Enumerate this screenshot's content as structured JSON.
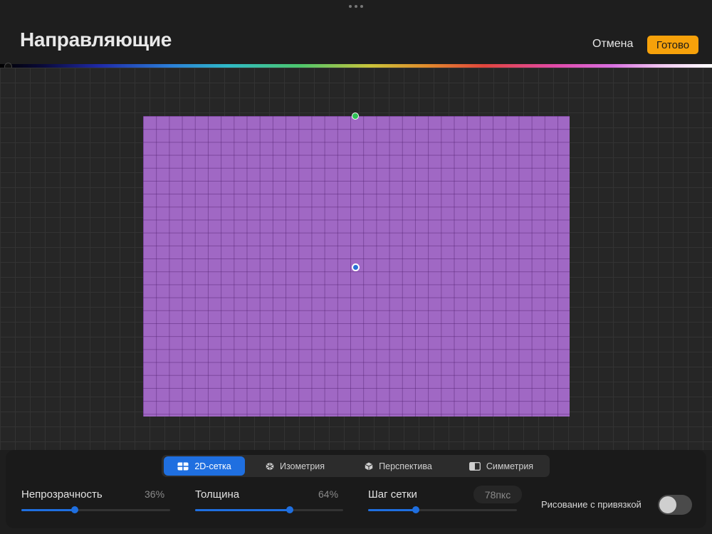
{
  "header": {
    "title": "Направляющие",
    "cancel_label": "Отмена",
    "done_label": "Готово",
    "accent_color": "#f6a10a"
  },
  "canvas": {
    "grid_color": "#a068c4"
  },
  "tabs": [
    {
      "label": "2D-сетка",
      "icon": "2d-grid-icon",
      "active": true
    },
    {
      "label": "Изометрия",
      "icon": "isometric-icon",
      "active": false
    },
    {
      "label": "Перспектива",
      "icon": "perspective-icon",
      "active": false
    },
    {
      "label": "Симметрия",
      "icon": "symmetry-icon",
      "active": false
    }
  ],
  "controls": {
    "opacity": {
      "label": "Непрозрачность",
      "value_text": "36%",
      "value": 0.36
    },
    "thickness": {
      "label": "Толщина",
      "value_text": "64%",
      "value": 0.64
    },
    "grid_size": {
      "label": "Шаг сетки",
      "value_text": "78пкс",
      "value": 0.32
    },
    "snap": {
      "label": "Рисование с привязкой",
      "on": false
    }
  },
  "accent_blue": "#1f6fe0"
}
